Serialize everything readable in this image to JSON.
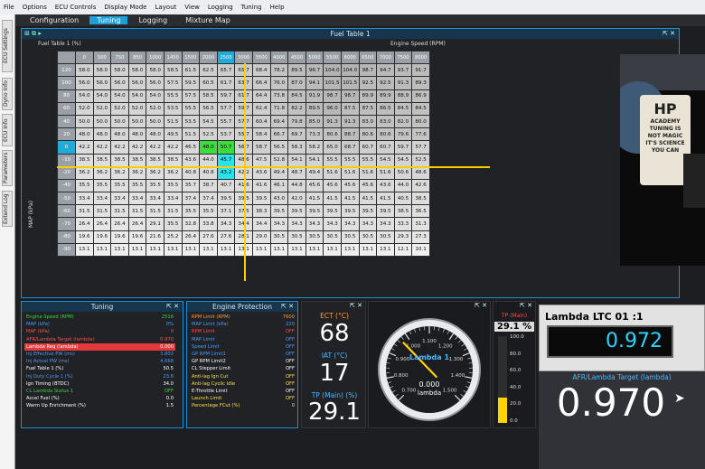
{
  "menubar": [
    "File",
    "Options",
    "ECU Controls",
    "Display Mode",
    "Layout",
    "View",
    "Logging",
    "Tuning",
    "Help"
  ],
  "sidetabs": [
    "ECU Settings",
    "Dyno Info",
    "ECU Info",
    "Parameters",
    "Extend Log"
  ],
  "tabs": [
    {
      "label": "Configuration",
      "active": false
    },
    {
      "label": "Tuning",
      "active": true
    },
    {
      "label": "Logging",
      "active": false
    },
    {
      "label": "Mixture Map",
      "active": false
    }
  ],
  "fuel": {
    "title": "Fuel Table 1",
    "table_label": "Fuel Table 1 (%)",
    "speed_label": "Engine Speed (RPM)",
    "map_label": "MAP (kPa)",
    "cols": [
      "0",
      "500",
      "750",
      "850",
      "1000",
      "1450",
      "1500",
      "2000",
      "2500",
      "3000",
      "3500",
      "4000",
      "4500",
      "5000",
      "5500",
      "6000",
      "6500",
      "7000",
      "7500",
      "8000"
    ],
    "rows": [
      {
        "h": "120",
        "v": [
          "58.0",
          "58.0",
          "58.0",
          "58.0",
          "58.0",
          "58.5",
          "61.5",
          "62.5",
          "65.7",
          "65.7",
          "68.4",
          "78.2",
          "89.5",
          "96.7",
          "104.0",
          "104.0",
          "98.7",
          "94.7",
          "93.7",
          "91.7"
        ]
      },
      {
        "h": "100",
        "v": [
          "56.0",
          "56.0",
          "56.0",
          "56.0",
          "56.0",
          "57.5",
          "59.5",
          "60.5",
          "61.7",
          "63.7",
          "66.4",
          "76.0",
          "87.0",
          "94.1",
          "101.5",
          "101.5",
          "92.5",
          "92.5",
          "91.3",
          "89.3"
        ]
      },
      {
        "h": "80",
        "v": [
          "54.0",
          "54.0",
          "54.0",
          "54.0",
          "54.0",
          "55.5",
          "57.5",
          "58.5",
          "59.7",
          "61.7",
          "64.4",
          "73.8",
          "84.5",
          "91.9",
          "98.7",
          "98.7",
          "89.9",
          "89.9",
          "88.9",
          "86.9"
        ]
      },
      {
        "h": "60",
        "v": [
          "52.0",
          "52.0",
          "52.0",
          "52.0",
          "52.0",
          "53.5",
          "55.5",
          "56.5",
          "57.7",
          "59.7",
          "62.4",
          "71.8",
          "82.2",
          "89.5",
          "96.0",
          "87.5",
          "87.5",
          "86.5",
          "84.5",
          "84.5"
        ]
      },
      {
        "h": "40",
        "v": [
          "50.0",
          "50.0",
          "50.0",
          "50.0",
          "50.0",
          "51.5",
          "53.5",
          "54.5",
          "55.7",
          "57.7",
          "60.4",
          "69.4",
          "79.8",
          "85.0",
          "91.3",
          "91.3",
          "83.0",
          "83.0",
          "82.0",
          "80.0"
        ]
      },
      {
        "h": "20",
        "v": [
          "48.0",
          "48.0",
          "48.0",
          "48.0",
          "48.0",
          "49.5",
          "51.5",
          "52.5",
          "53.7",
          "55.7",
          "58.4",
          "66.7",
          "69.7",
          "73.3",
          "80.6",
          "88.7",
          "80.6",
          "80.6",
          "79.6",
          "77.6"
        ]
      },
      {
        "h": "0",
        "sel": true,
        "v": [
          "42.2",
          "42.2",
          "42.2",
          "42.2",
          "42.2",
          "42.2",
          "46.5",
          "48.0",
          "50.7",
          "56.7",
          "58.7",
          "56.5",
          "58.3",
          "58.2",
          "65.0",
          "68.7",
          "60.7",
          "60.7",
          "59.7",
          "57.7"
        ]
      },
      {
        "h": "-10",
        "v": [
          "38.5",
          "38.5",
          "38.5",
          "38.5",
          "38.5",
          "38.5",
          "43.6",
          "44.0",
          "45.7",
          "48.6",
          "47.5",
          "52.8",
          "54.1",
          "54.1",
          "55.5",
          "55.5",
          "55.5",
          "54.5",
          "54.5",
          "52.5"
        ]
      },
      {
        "h": "-20",
        "v": [
          "36.2",
          "36.2",
          "36.2",
          "36.2",
          "36.2",
          "36.2",
          "40.8",
          "40.8",
          "43.2",
          "42.2",
          "43.6",
          "49.4",
          "48.7",
          "49.4",
          "51.6",
          "51.6",
          "51.6",
          "51.6",
          "50.6",
          "48.6"
        ]
      },
      {
        "h": "-40",
        "v": [
          "35.5",
          "35.5",
          "35.5",
          "35.5",
          "35.5",
          "35.5",
          "35.7",
          "38.7",
          "40.7",
          "41.6",
          "41.6",
          "46.1",
          "44.8",
          "45.6",
          "45.6",
          "45.6",
          "45.6",
          "43.6",
          "44.0",
          "42.6"
        ]
      },
      {
        "h": "-50",
        "v": [
          "33.4",
          "33.4",
          "33.4",
          "33.4",
          "33.4",
          "33.4",
          "37.4",
          "37.4",
          "39.5",
          "39.5",
          "39.5",
          "43.0",
          "42.0",
          "41.5",
          "41.5",
          "41.5",
          "41.5",
          "41.5",
          "40.5",
          "38.5"
        ]
      },
      {
        "h": "-60",
        "v": [
          "31.5",
          "31.5",
          "31.5",
          "31.5",
          "31.5",
          "31.5",
          "35.5",
          "35.5",
          "37.1",
          "37.5",
          "38.3",
          "39.5",
          "39.5",
          "39.5",
          "39.5",
          "39.5",
          "39.5",
          "39.5",
          "38.5",
          "36.5"
        ]
      },
      {
        "h": "-70",
        "v": [
          "26.4",
          "26.4",
          "26.4",
          "26.4",
          "29.1",
          "35.5",
          "32.8",
          "33.8",
          "34.3",
          "34.4",
          "34.4",
          "34.3",
          "34.3",
          "34.3",
          "34.3",
          "34.3",
          "34.3",
          "34.3",
          "33.3",
          "31.3"
        ]
      },
      {
        "h": "-80",
        "v": [
          "19.6",
          "19.6",
          "19.6",
          "19.6",
          "21.6",
          "25.2",
          "26.4",
          "27.6",
          "27.6",
          "28.1",
          "29.0",
          "30.5",
          "30.5",
          "30.5",
          "30.5",
          "30.5",
          "30.5",
          "30.5",
          "29.3",
          "27.3"
        ]
      },
      {
        "h": "-90",
        "v": [
          "13.1",
          "13.1",
          "13.1",
          "13.1",
          "13.1",
          "13.1",
          "13.1",
          "13.1",
          "13.1",
          "13.1",
          "13.1",
          "13.1",
          "13.1",
          "13.1",
          "13.1",
          "13.1",
          "13.1",
          "13.1",
          "12.1",
          "10.1"
        ]
      }
    ],
    "sel_col": 8
  },
  "video": {
    "sign": [
      "HP",
      "ACADEMY",
      "TUNING IS",
      "NOT MAGIC",
      "IT'S SCIENCE",
      "YOU CAN"
    ]
  },
  "tuning": {
    "title": "Tuning",
    "items": [
      {
        "l": "Engine Speed (RPM)",
        "v": "2516",
        "c": "#3dd63d"
      },
      {
        "l": "MAP (kPa)",
        "v": "0%",
        "c": "#4a9cff"
      },
      {
        "l": "MAF (kPa)",
        "v": "0",
        "c": "#ff4c4c"
      },
      {
        "l": "AFR/Lambda Target (lambda)",
        "v": "0.970",
        "c": "#ff4c4c"
      },
      {
        "l": "Lambda Req (lambda)",
        "v": "0.000",
        "c": "#ffffff",
        "hl": true
      },
      {
        "l": "Inj Effective PW (ms)",
        "v": "3.802",
        "c": "#4a9cff"
      },
      {
        "l": "Inj Actual PW (ms)",
        "v": "4.668",
        "c": "#4a9cff"
      },
      {
        "l": "Fuel Table 1 (%)",
        "v": "50.5",
        "c": "#ffffff"
      },
      {
        "l": "Inj Duty Cycle 1 (%)",
        "v": "23.8",
        "c": "#4a9cff"
      },
      {
        "l": "Ign Timing (BTDC)",
        "v": "34.0",
        "c": "#ffffff"
      },
      {
        "l": "CL Lambda Status 1",
        "v": "OFF",
        "c": "#3dd63d"
      },
      {
        "l": "Accel Fuel (%)",
        "v": "0.0",
        "c": "#ffffff"
      },
      {
        "l": "Warm Up Enrichment (%)",
        "v": "1.5",
        "c": "#ffffff"
      }
    ]
  },
  "protect": {
    "title": "Engine Protection",
    "items": [
      {
        "l": "RPM Limit (RPM)",
        "v": "7600",
        "c": "#ff9a3c"
      },
      {
        "l": "MAP Limit (kPa)",
        "v": "220",
        "c": "#4a9cff"
      },
      {
        "l": "RPM Limit",
        "v": "OFF",
        "c": "#ff4c4c"
      },
      {
        "l": "MAP Limit",
        "v": "OFF",
        "c": "#4a9cff"
      },
      {
        "l": "Speed Limit",
        "v": "OFF",
        "c": "#4a9cff"
      },
      {
        "l": "GP RPM Limit1",
        "v": "OFF",
        "c": "#4a9cff"
      },
      {
        "l": "GP RPM Limit2",
        "v": "OFF",
        "c": "#ffffff"
      },
      {
        "l": "CL Stepper Limit",
        "v": "OFF",
        "c": "#ffffff"
      },
      {
        "l": "Anti-lag Ign Cut",
        "v": "OFF",
        "c": "#ffe04a"
      },
      {
        "l": "Anti-lag Cyclic Idle",
        "v": "OFF",
        "c": "#ffe04a"
      },
      {
        "l": "E-Throttle Limit",
        "v": "OFF",
        "c": "#ffffff"
      },
      {
        "l": "Launch Limit",
        "v": "OFF",
        "c": "#ffe04a"
      },
      {
        "l": "Percentage FCut (%)",
        "v": "0",
        "c": "#ffe04a"
      }
    ]
  },
  "ect": {
    "label": "ECT (°C)",
    "value": "68"
  },
  "iat": {
    "label": "IAT (°C)",
    "value": "17"
  },
  "tpbox": {
    "label": "TP (Main) (%)",
    "value": "29.1"
  },
  "gauge": {
    "name": "Lambda 1",
    "value": "0.000",
    "unit": "lambda",
    "ticks": [
      "0.700",
      "0.800",
      "0.900",
      "1.000",
      "1.100",
      "1.200",
      "1.300",
      "1.400",
      "1.500"
    ],
    "tick_short": [
      "",
      "0.800",
      "0.900",
      "1.000",
      "1.100",
      "1.120",
      "1.140",
      "1.160",
      "1.180"
    ],
    "needle": 0.97
  },
  "tpbar": {
    "label": "TP (Main)",
    "value": "29.1",
    "unit": "%",
    "fill": 0.291,
    "ticks": [
      "100.0",
      "80.0",
      "60.0",
      "40.0",
      "20.0",
      "0.0"
    ]
  },
  "ltc": {
    "label": "Lambda LTC 01 :1",
    "value": "0.972"
  },
  "afr": {
    "label": "AFR/Lambda Target (lambda)",
    "value": "0.970"
  }
}
